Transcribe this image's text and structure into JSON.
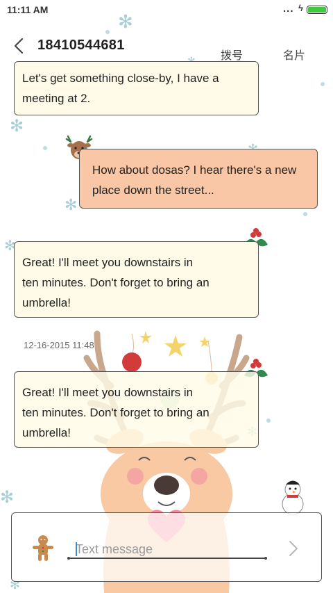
{
  "status_bar": {
    "time": "11:11 AM",
    "overflow": "...",
    "charging": "ϟ",
    "battery_color": "#3ec93e"
  },
  "header": {
    "contact": "18410544681",
    "dial_label": "拨号",
    "card_label": "名片"
  },
  "messages": [
    {
      "direction": "incoming",
      "lines": [
        "Let's get something close-by, I have a",
        "meeting at 2."
      ]
    },
    {
      "direction": "outgoing",
      "lines": [
        "How about dosas? I hear there's a new",
        "place down the street..."
      ]
    },
    {
      "direction": "incoming",
      "lines": [
        "Great! I'll meet you downstairs in",
        "ten minutes. Don't forget to bring an",
        "umbrella!"
      ]
    },
    {
      "direction": "incoming",
      "lines": [
        "Great! I'll meet you downstairs in",
        "ten minutes. Don't forget to bring an",
        "umbrella!"
      ]
    }
  ],
  "timestamp": "12-16-2015 11:48",
  "composer": {
    "placeholder": "Text message",
    "send_icon": "chevron-right-icon"
  },
  "colors": {
    "incoming_bubble": "#fffbe8",
    "outgoing_bubble": "#f9c7a5",
    "accent": "#3b8ad8",
    "snowflake": "#a8cfd6"
  }
}
